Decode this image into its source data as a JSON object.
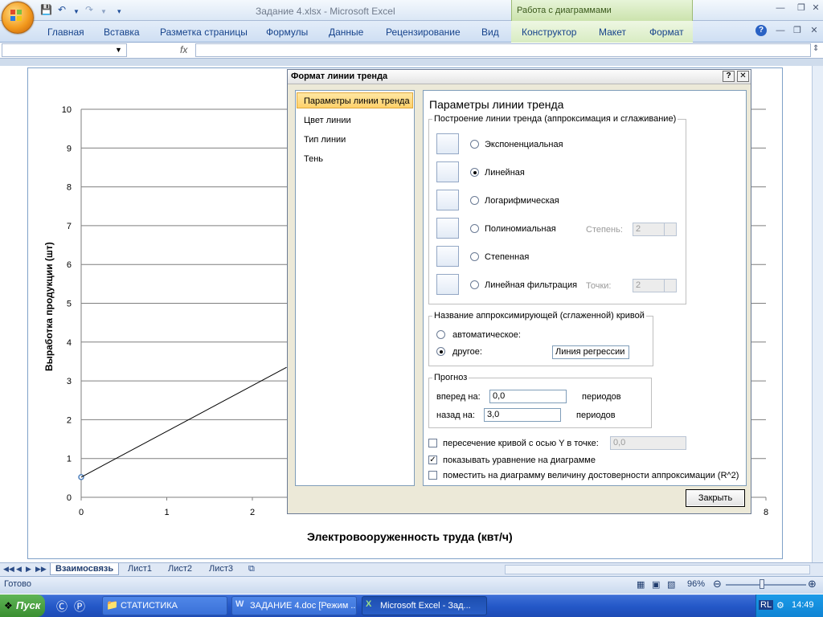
{
  "window": {
    "title": "Задание 4.xlsx - Microsoft Excel",
    "context_group": "Работа с диаграммами"
  },
  "ribbon": {
    "tabs": [
      "Главная",
      "Вставка",
      "Разметка страницы",
      "Формулы",
      "Данные",
      "Рецензирование",
      "Вид",
      "Конструктор",
      "Макет",
      "Формат"
    ]
  },
  "formula_bar": {
    "fx": "fx",
    "name_box": ""
  },
  "chart_data": {
    "type": "line",
    "title": "",
    "xlabel": "Электровооруженность труда (квт/ч)",
    "ylabel": "Выработка продукции (шт)",
    "xlim": [
      0,
      8
    ],
    "ylim": [
      0,
      10
    ],
    "x_ticks": [
      "0",
      "1",
      "2",
      "8"
    ],
    "y_ticks": [
      "0",
      "1",
      "2",
      "3",
      "4",
      "5",
      "6",
      "7",
      "8",
      "9",
      "10"
    ],
    "grid": true,
    "series": [
      {
        "x": [
          0
        ],
        "y": [
          0.52
        ],
        "marker": true
      },
      {
        "x": [
          0,
          2.4
        ],
        "y": [
          0.52,
          3.35
        ],
        "style": "line"
      }
    ]
  },
  "dialog": {
    "title": "Формат линии тренда",
    "help_glyph": "?",
    "close_glyph": "✕",
    "nav": [
      "Параметры линии тренда",
      "Цвет линии",
      "Тип линии",
      "Тень"
    ],
    "heading": "Параметры линии тренда",
    "build_group": "Построение линии тренда (аппроксимация и сглаживание)",
    "types": [
      "Экспоненциальная",
      "Линейная",
      "Логарифмическая",
      "Полиномиальная",
      "Степенная",
      "Линейная фильтрация"
    ],
    "selected_type": "Линейная",
    "degree_label": "Степень:",
    "degree_value": "2",
    "points_label": "Точки:",
    "points_value": "2",
    "name_group": "Название аппроксимирующей (сглаженной) кривой",
    "name_auto": "автоматическое:",
    "name_other": "другое:",
    "name_value": "Линия регрессии",
    "forecast_group": "Прогноз",
    "forward_label": "вперед на:",
    "forward_value": "0,0",
    "backward_label": "назад на:",
    "backward_value": "3,0",
    "periods": "периодов",
    "intercept_label": "пересечение кривой с осью Y в точке:",
    "intercept_value": "0,0",
    "show_equation": "показывать уравнение на диаграмме",
    "show_r2": "поместить на диаграмму величину достоверности аппроксимации (R^2)",
    "close_button": "Закрыть"
  },
  "sheets": {
    "tabs": [
      "Взаимосвязь",
      "Лист1",
      "Лист2",
      "Лист3"
    ],
    "active": "Взаимосвязь"
  },
  "status": {
    "ready": "Готово",
    "zoom": "96%"
  },
  "taskbar": {
    "start": "Пуск",
    "tasks": [
      "СТАТИСТИКА",
      "ЗАДАНИЕ 4.doc [Режим ...",
      "Microsoft Excel - Зад..."
    ],
    "lang": "RL",
    "clock": "14:49"
  },
  "colors": {
    "accent": "#15428b",
    "dialog_bg": "#ece9d8",
    "nav_selected": "#ffd16a",
    "taskbar": "#2458c8"
  }
}
